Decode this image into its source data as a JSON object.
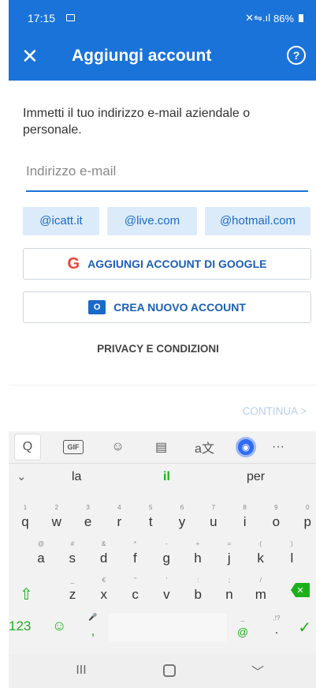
{
  "status": {
    "time": "17:15",
    "battery": "86%",
    "signal": "✕⇋.ıl"
  },
  "appbar": {
    "close_icon": "close-icon",
    "title": "Aggiungi account",
    "help_icon": "help-icon",
    "help_glyph": "?"
  },
  "prompt": "Immetti il tuo indirizzo e-mail aziendale o personale.",
  "email": {
    "placeholder": "Indirizzo e-mail",
    "value": ""
  },
  "chips": [
    "@icatt.it",
    "@live.com",
    "@hotmail.com"
  ],
  "google_button": {
    "label": "AGGIUNGI ACCOUNT DI GOOGLE",
    "icon": "google-icon",
    "glyph": "G"
  },
  "create_button": {
    "label": "CREA NUOVO ACCOUNT",
    "icon": "outlook-icon",
    "glyph": "O"
  },
  "privacy": "PRIVACY E CONDIZIONI",
  "continue": "CONTINUA >",
  "keyboard": {
    "toolbar": [
      "Q",
      "GIF",
      "☺",
      "▤",
      "a文",
      "◉",
      "···"
    ],
    "suggestions": {
      "collapse": "⌄",
      "left": "la",
      "center": "il",
      "right": "per"
    },
    "row1": [
      {
        "sec": "1",
        "pri": "q"
      },
      {
        "sec": "2",
        "pri": "w"
      },
      {
        "sec": "3",
        "pri": "e"
      },
      {
        "sec": "4",
        "pri": "r"
      },
      {
        "sec": "5",
        "pri": "t"
      },
      {
        "sec": "6",
        "pri": "y"
      },
      {
        "sec": "7",
        "pri": "u"
      },
      {
        "sec": "8",
        "pri": "i"
      },
      {
        "sec": "9",
        "pri": "o"
      },
      {
        "sec": "0",
        "pri": "p"
      }
    ],
    "row2": [
      {
        "sec": "@",
        "pri": "a"
      },
      {
        "sec": "#",
        "pri": "s"
      },
      {
        "sec": "&",
        "pri": "d"
      },
      {
        "sec": "*",
        "pri": "f"
      },
      {
        "sec": "-",
        "pri": "g"
      },
      {
        "sec": "+",
        "pri": "h"
      },
      {
        "sec": "=",
        "pri": "j"
      },
      {
        "sec": "(",
        "pri": "k"
      },
      {
        "sec": ")",
        "pri": "l"
      }
    ],
    "row3": [
      {
        "sec": "_",
        "pri": "z"
      },
      {
        "sec": "€",
        "pri": "x"
      },
      {
        "sec": "\"",
        "pri": "c"
      },
      {
        "sec": "'",
        "pri": "v"
      },
      {
        "sec": ":",
        "pri": "b"
      },
      {
        "sec": ";",
        "pri": "n"
      },
      {
        "sec": "/",
        "pri": "m"
      }
    ],
    "row4": {
      "num": "123",
      "emoji": "☺",
      "comma_sec": "🎤",
      "comma": ",",
      "at_sec": "_",
      "at": "@",
      "dot_sec": ",!?",
      "dot": ".",
      "enter": "✓"
    },
    "shift": "⇧",
    "backspace": "✕"
  },
  "nav": {
    "recent": "III",
    "home": "",
    "back": "﹀"
  }
}
